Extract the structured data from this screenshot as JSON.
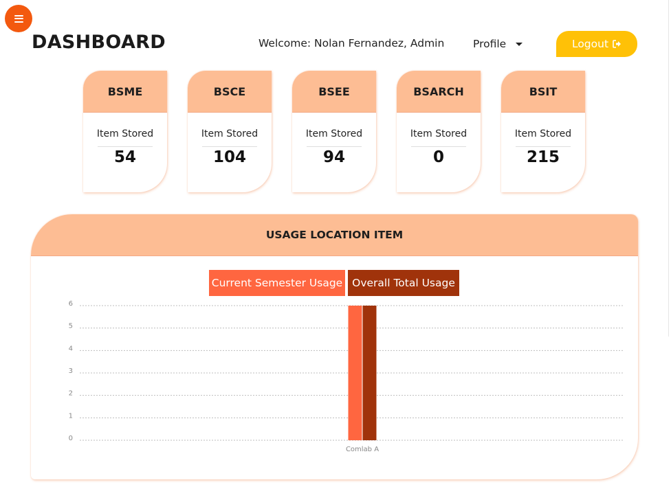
{
  "header": {
    "title": "DASHBOARD",
    "welcome": "Welcome: Nolan Fernandez, Admin",
    "profile_label": "Profile",
    "logout_label": "Logout"
  },
  "colors": {
    "menu_button": "#f3590f",
    "card_header": "#fdbd94",
    "logout_button": "#ffc107",
    "current_series": "#ff6640",
    "overall_series": "#a0330b"
  },
  "icons": {
    "menu": "hamburger-icon",
    "profile_dropdown": "caret-down-icon",
    "logout": "sign-out-icon"
  },
  "cards": [
    {
      "name": "BSME",
      "label": "Item Stored",
      "value": "54"
    },
    {
      "name": "BSCE",
      "label": "Item Stored",
      "value": "104"
    },
    {
      "name": "BSEE",
      "label": "Item Stored",
      "value": "94"
    },
    {
      "name": "BSARCH",
      "label": "Item Stored",
      "value": "0"
    },
    {
      "name": "BSIT",
      "label": "Item Stored",
      "value": "215"
    }
  ],
  "usage_panel": {
    "title": "USAGE LOCATION ITEM"
  },
  "chart_data": {
    "type": "bar",
    "categories": [
      "Comlab A"
    ],
    "series": [
      {
        "name": "Current Semester Usage",
        "values": [
          6
        ]
      },
      {
        "name": "Overall Total Usage",
        "values": [
          6
        ]
      }
    ],
    "y_ticks": [
      "0",
      "1",
      "2",
      "3",
      "4",
      "5",
      "6"
    ],
    "ylim": [
      0,
      6
    ],
    "grid": true,
    "legend_position": "top-center",
    "title": "",
    "xlabel": "",
    "ylabel": ""
  }
}
